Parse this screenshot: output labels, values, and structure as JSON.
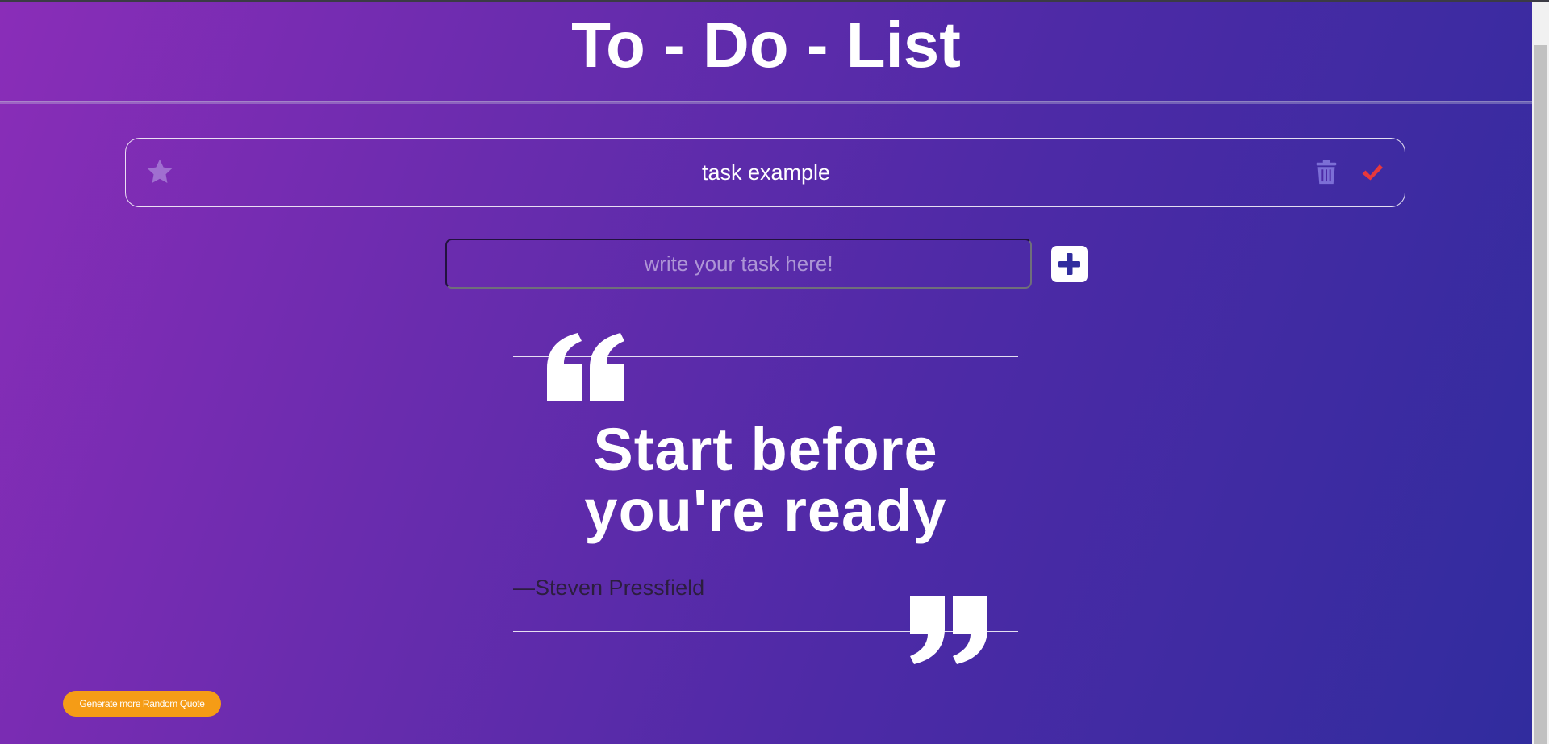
{
  "page": {
    "title": "To - Do - List"
  },
  "tasks": [
    {
      "text": "task example",
      "star_icon": "star-icon",
      "delete_icon": "trash-icon",
      "complete_icon": "check-icon"
    }
  ],
  "new_task": {
    "placeholder": "write your task here!",
    "value": "",
    "add_icon": "plus-square-icon"
  },
  "quote": {
    "text": "Start before you're ready",
    "author": "—Steven Pressfield",
    "open_mark_icon": "quote-open-icon",
    "close_mark_icon": "quote-close-icon"
  },
  "actions": {
    "random_quote_label": "Generate more Random Quote"
  },
  "colors": {
    "background_start": "#8a2db8",
    "background_end": "#302c9e",
    "star": "#a06fd0",
    "trash": "#7c6fd6",
    "check": "#e8383c",
    "random_button": "#f59c16",
    "author_text": "#2c1e3e"
  }
}
